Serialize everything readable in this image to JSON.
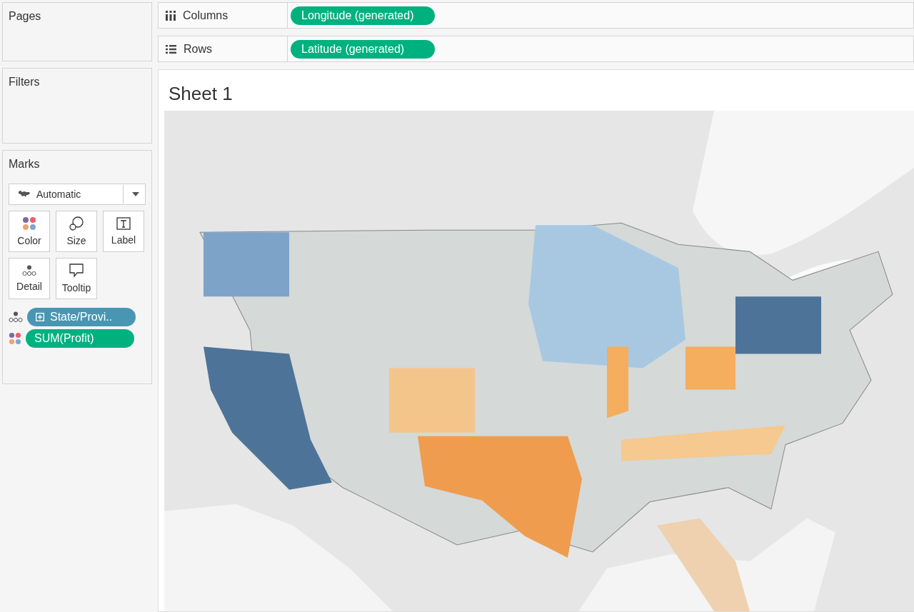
{
  "cards": {
    "pages": {
      "title": "Pages"
    },
    "filters": {
      "title": "Filters"
    }
  },
  "shelves": [
    {
      "kind": "columns",
      "label": "Columns",
      "pills": [
        {
          "text": "Longitude (generated)",
          "kind": "measure"
        }
      ]
    },
    {
      "kind": "rows",
      "label": "Rows",
      "pills": [
        {
          "text": "Latitude (generated)",
          "kind": "measure"
        }
      ]
    }
  ],
  "marks": {
    "title": "Marks",
    "mark_type": "Automatic",
    "buttons": [
      {
        "kind": "color",
        "label": "Color"
      },
      {
        "kind": "size",
        "label": "Size"
      },
      {
        "kind": "label",
        "label": "Label"
      },
      {
        "kind": "detail",
        "label": "Detail"
      },
      {
        "kind": "tooltip",
        "label": "Tooltip"
      }
    ],
    "fields": [
      {
        "kind": "detail",
        "continuous": false,
        "text": "State/Provi.."
      },
      {
        "kind": "color",
        "continuous": true,
        "text": "SUM(Profit)"
      }
    ]
  },
  "sheet": {
    "title": "Sheet 1"
  }
}
